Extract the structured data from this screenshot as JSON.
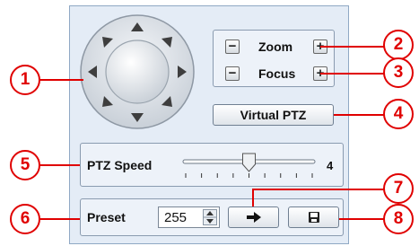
{
  "zoom": {
    "label": "Zoom",
    "minus": "−",
    "plus": "+"
  },
  "focus": {
    "label": "Focus",
    "minus": "−",
    "plus": "+"
  },
  "virtual_ptz": {
    "label": "Virtual PTZ"
  },
  "ptz_speed": {
    "label": "PTZ Speed",
    "value": "4",
    "level": 4,
    "max": 8
  },
  "preset": {
    "label": "Preset",
    "value": "255",
    "go_icon": "arrow-right-icon",
    "save_icon": "floppy-disk-icon"
  },
  "callouts": [
    "1",
    "2",
    "3",
    "4",
    "5",
    "6",
    "7",
    "8"
  ],
  "colors": {
    "callout": "#e00000",
    "panel": "#e4ecf6",
    "border": "#8a9bb0"
  }
}
